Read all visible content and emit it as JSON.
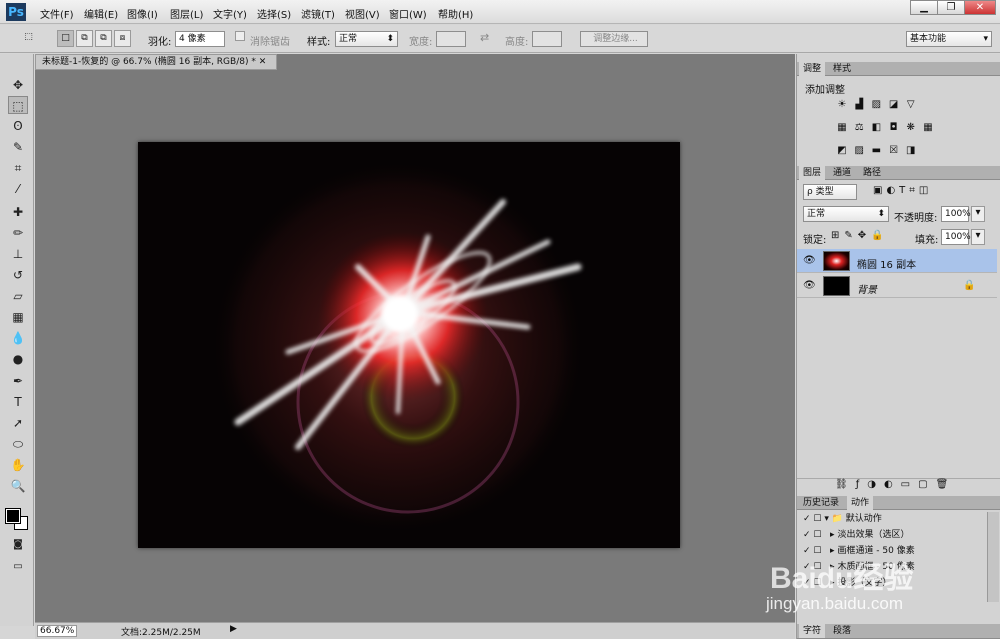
{
  "app": {
    "logo": "Ps",
    "workspace": "基本功能"
  },
  "menu": [
    "文件(F)",
    "编辑(E)",
    "图像(I)",
    "图层(L)",
    "文字(Y)",
    "选择(S)",
    "滤镜(T)",
    "视图(V)",
    "窗口(W)",
    "帮助(H)"
  ],
  "window_controls": [
    "▁",
    "❐",
    "✕"
  ],
  "options": {
    "feather_label": "羽化:",
    "feather_value": "4 像素",
    "antialias": "消除锯齿",
    "style_label": "样式:",
    "style_value": "正常",
    "width_label": "宽度:",
    "height_label": "高度:",
    "refine_edge": "调整边缘..."
  },
  "document": {
    "tab_title": "未标题-1-恢复的 @ 66.7% (椭圆 16 副本, RGB/8) *",
    "zoom": "66.67%",
    "doc_info": "文档:2.25M/2.25M"
  },
  "adjust_panel": {
    "tabs": [
      "调整",
      "样式"
    ],
    "title": "添加调整"
  },
  "layers_panel": {
    "tabs": [
      "图层",
      "通道",
      "路径"
    ],
    "filter_kind": "ρ 类型",
    "blend_mode": "正常",
    "opacity_label": "不透明度:",
    "opacity_value": "100%",
    "lock_label": "锁定:",
    "fill_label": "填充:",
    "fill_value": "100%",
    "layers": [
      {
        "name": "椭圆 16 副本",
        "selected": true
      },
      {
        "name": "背景",
        "selected": false
      }
    ]
  },
  "history_panel": {
    "tabs": [
      "历史记录",
      "动作"
    ],
    "actions": [
      "默认动作",
      "淡出效果（选区）",
      "画框通道 - 50 像素",
      "木质画框 - 50 像素",
      "投影（文字）"
    ]
  },
  "bottom_tabs": [
    "字符",
    "段落"
  ],
  "watermark": {
    "text1": "Baidu经验",
    "text2": "jingyan.baidu.com"
  }
}
